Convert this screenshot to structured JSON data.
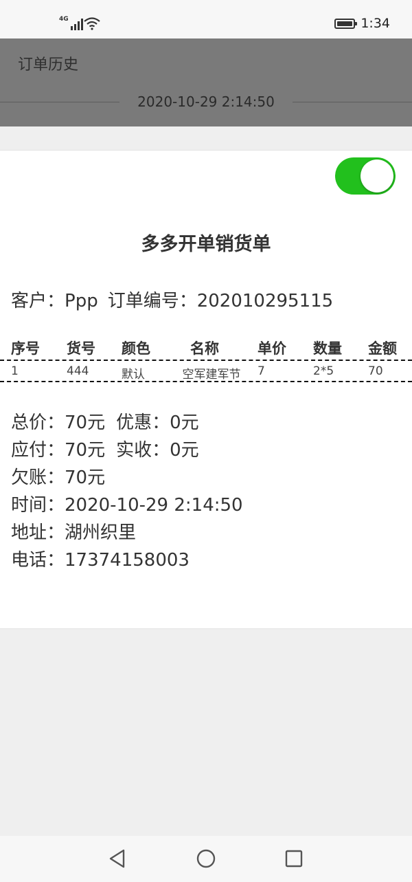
{
  "status_bar": {
    "network": "4G",
    "time": "1:34"
  },
  "header": {
    "title": "订单历史",
    "date": "2020-10-29 2:14:50"
  },
  "receipt": {
    "toggle_on": true,
    "toggle_color": "#22c01d",
    "title": "多多开单销货单",
    "customer_label": "客户：",
    "customer_value": "Ppp",
    "order_no_label": "订单编号：",
    "order_no_value": "202010295115",
    "table": {
      "columns": [
        "序号",
        "货号",
        "颜色",
        "名称",
        "单价",
        "数量",
        "金额"
      ],
      "rows": [
        [
          "1",
          "444",
          "默认",
          "空军建军节",
          "7",
          "2*5",
          "70"
        ]
      ]
    },
    "summary": {
      "total": "总价：70元",
      "discount": "优惠：0元",
      "payable": "应付：70元",
      "received": "实收：0元",
      "owed": "欠账：70元",
      "time": "时间：2020-10-29 2:14:50",
      "address": "地址：湖州织里",
      "phone": "电话：17374158003"
    }
  },
  "nav_bar": {
    "back_icon": "triangle-back-icon",
    "home_icon": "circle-home-icon",
    "recent_icon": "square-recent-icon"
  }
}
